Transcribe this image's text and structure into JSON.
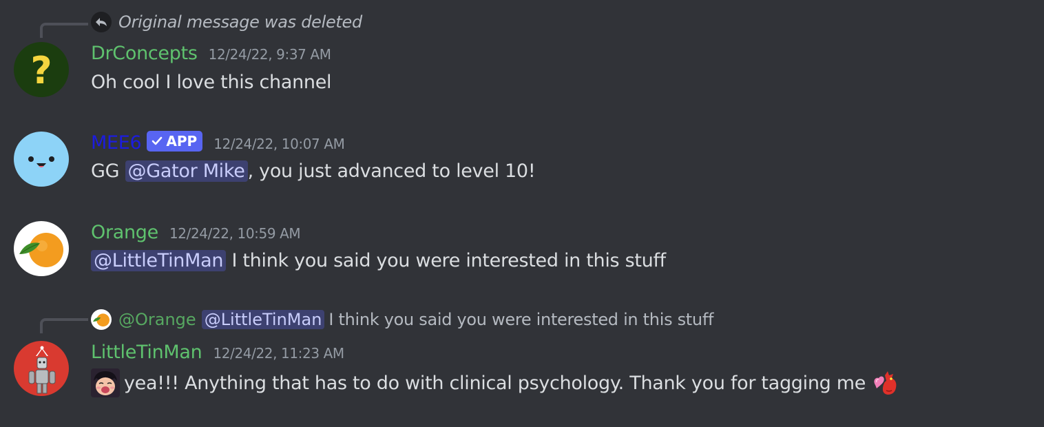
{
  "messages": [
    {
      "reply": {
        "icon": "reply-arrow-icon",
        "text": "Original message was deleted"
      },
      "username": "DrConcepts",
      "username_color": "#5fc26e",
      "avatar": "question-mark-avatar",
      "timestamp": "12/24/22, 9:37 AM",
      "text": "Oh cool I love this channel"
    },
    {
      "username": "MEE6",
      "username_color": "#1c1ce0",
      "badge": "APP",
      "avatar": "mee6-face-avatar",
      "timestamp": "12/24/22, 10:07 AM",
      "text_before": "GG ",
      "mention": "@Gator Mike",
      "text_after": ", you just advanced to level 10!"
    },
    {
      "username": "Orange",
      "username_color": "#5fc26e",
      "avatar": "orange-fruit-avatar",
      "timestamp": "12/24/22, 10:59 AM",
      "mention": "@LittleTinMan",
      "text_after": " I think you said you were interested in this stuff"
    },
    {
      "reply": {
        "name": "@Orange",
        "mention": "@LittleTinMan",
        "text": "I think you said you were interested in this stuff"
      },
      "username": "LittleTinMan",
      "username_color": "#5fc26e",
      "avatar": "tin-man-avatar",
      "timestamp": "12/24/22, 11:23 AM",
      "text": "yea!!! Anything that has to do with clinical psychology. Thank you for tagging me",
      "leading_emoji": "anime-face-emoji",
      "trailing_emoji": "heart-dragon-emoji"
    }
  ],
  "colors": {
    "background": "#313338",
    "mention_bg": "rgba(88,101,242,0.3)",
    "mention_text": "#c9cdfb",
    "timestamp": "#949ba4",
    "app_badge": "#5865f2"
  }
}
